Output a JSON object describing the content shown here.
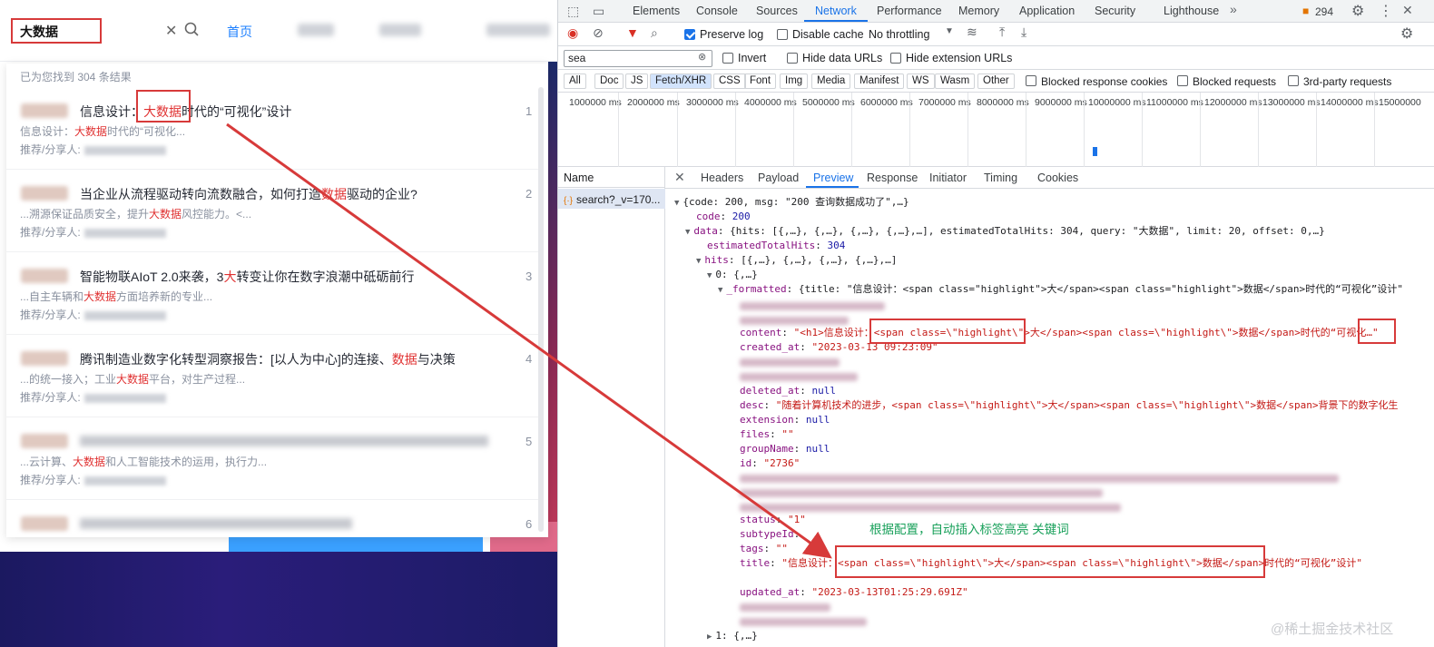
{
  "site": {
    "search_value": "大数据",
    "nav_home": "首页",
    "result_count": "已为您找到 304 条结果",
    "share_label": "推荐/分享人:",
    "results": [
      {
        "num": "1",
        "title_pre": "信息设计：",
        "title_hl": "大数据",
        "title_post": "时代的“可视化”设计",
        "desc_pre": "信息设计：",
        "desc_hl": "大数据",
        "desc_post": "时代的“可视化..."
      },
      {
        "num": "2",
        "title_pre": "当企业从流程驱动转向流数融合，如何打造",
        "title_hl": "数据",
        "title_post": "驱动的企业?",
        "desc_pre": "...溯源保证品质安全，提升",
        "desc_hl": "大数据",
        "desc_post": "风控能力。<..."
      },
      {
        "num": "3",
        "title_pre": "智能物联AIoT 2.0来袭，3",
        "title_hl": "大",
        "title_post": "转变让你在数字浪潮中砥砺前行",
        "desc_pre": "...自主车辆和",
        "desc_hl": "大数据",
        "desc_post": "方面培养新的专业..."
      },
      {
        "num": "4",
        "title_pre": "腾讯制造业数字化转型洞察报告：[以人为中心]的连接、",
        "title_hl": "数据",
        "title_post": "与决策",
        "desc_pre": "...的统一接入；工业",
        "desc_hl": "大数据",
        "desc_post": "平台，对生产过程..."
      },
      {
        "num": "5",
        "title_pre": "",
        "title_hl": "",
        "title_post": "",
        "desc_pre": "...云计算、",
        "desc_hl": "大数据",
        "desc_post": "和人工智能技术的运用，执行力..."
      },
      {
        "num": "6",
        "title_pre": "",
        "title_hl": "",
        "title_post": "",
        "desc_pre": "",
        "desc_hl": "",
        "desc_post": ""
      }
    ]
  },
  "devtools": {
    "tabs": [
      "Elements",
      "Console",
      "Sources",
      "Network",
      "Performance",
      "Memory",
      "Application",
      "Security",
      "Lighthouse"
    ],
    "active_tab": "Network",
    "issue_count": "294",
    "toolbar": {
      "preserve_log": "Preserve log",
      "disable_cache": "Disable cache",
      "throttling": "No throttling"
    },
    "filter": {
      "value": "sea",
      "invert": "Invert",
      "hide_data": "Hide data URLs",
      "hide_ext": "Hide extension URLs"
    },
    "types": [
      "All",
      "Doc",
      "JS",
      "Fetch/XHR",
      "CSS",
      "Font",
      "Img",
      "Media",
      "Manifest",
      "WS",
      "Wasm",
      "Other"
    ],
    "selected_type": "Fetch/XHR",
    "blocked_cookies": "Blocked response cookies",
    "blocked_requests": "Blocked requests",
    "third_party": "3rd-party requests",
    "timeline_labels": [
      "1000000 ms",
      "2000000 ms",
      "3000000 ms",
      "4000000 ms",
      "5000000 ms",
      "6000000 ms",
      "7000000 ms",
      "8000000 ms",
      "9000000 ms",
      "10000000 ms",
      "11000000 ms",
      "12000000 ms",
      "13000000 ms",
      "14000000 ms",
      "15000000"
    ],
    "name_header": "Name",
    "request_name": "search?_v=170...",
    "detail_tabs": [
      "Headers",
      "Payload",
      "Preview",
      "Response",
      "Initiator",
      "Timing",
      "Cookies"
    ],
    "active_detail": "Preview",
    "preview": {
      "root": "{code: 200, msg: \"200 查询数据成功了\",…}",
      "code_key": "code",
      "code_val": "200",
      "data_key": "data",
      "data_summary": "{hits: [{,…}, {,…}, {,…}, {,…},…], estimatedTotalHits: 304, query: \"大数据\", limit: 20, offset: 0,…}",
      "eth_key": "estimatedTotalHits",
      "eth_val": "304",
      "hits_key": "hits",
      "hits_summary": "[{,…}, {,…}, {,…}, {,…},…]",
      "item0": "0: {,…}",
      "formatted_key": "_formatted",
      "formatted_summary": "{title: \"信息设计：<span class=\"highlight\">大</span><span class=\"highlight\">数据</span>时代的“可视化”设计\"",
      "content_key": "content",
      "content_val": "\"<h1>信息设计：<span class=\\\"highlight\\\">大</span><span class=\\\"highlight\\\">数据</span>时代的“可视化…\"",
      "created_key": "created_at",
      "created_val": "\"2023-03-13 09:23:09\"",
      "deleted_key": "deleted_at",
      "deleted_val": "null",
      "desc_key": "desc",
      "desc_val": "\"随着计算机技术的进步，<span class=\\\"highlight\\\">大</span><span class=\\\"highlight\\\">数据</span>背景下的数字化生",
      "extension_key": "extension",
      "extension_val": "null",
      "files_key": "files",
      "files_val": "\"\"",
      "group_key": "groupName",
      "group_val": "null",
      "id_key": "id",
      "id_val": "\"2736\"",
      "status_key": "status",
      "status_val": "\"1\"",
      "subtype_key": "subtypeId",
      "subtype_val": "",
      "tags_key": "tags",
      "tags_val": "\"\"",
      "title_key": "title",
      "title_val": "\"信息设计：<span class=\\\"highlight\\\">大</span><span class=\\\"highlight\\\">数据</span>时代的“可视化”设计\"",
      "updated_key": "updated_at",
      "updated_val": "\"2023-03-13T01:25:29.691Z\"",
      "item1": "1: {,…}"
    },
    "annotation": "根据配置，自动插入标签高亮 关键词"
  },
  "watermark": "@稀土掘金技术社区"
}
